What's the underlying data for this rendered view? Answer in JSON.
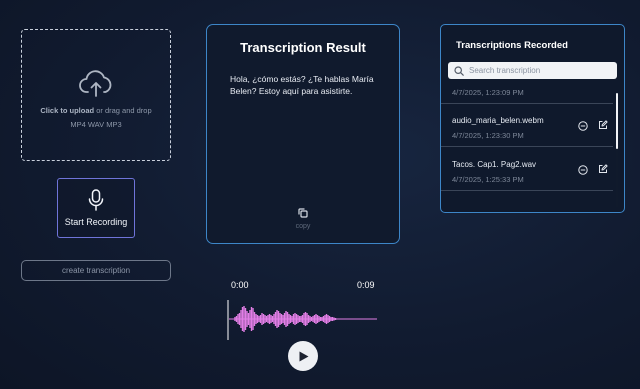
{
  "upload": {
    "icon": "cloud-upload-icon",
    "click_text": "Click to upload",
    "rest_text": " or drag and drop",
    "formats": "MP4 WAV MP3"
  },
  "record": {
    "icon": "microphone-icon",
    "label": "Start Recording"
  },
  "create": {
    "label": "create transcription"
  },
  "result": {
    "title": "Transcription Result",
    "text": "Hola, ¿cómo estás? ¿Te hablas María Belen? Estoy aquí para asistirte.",
    "copy_icon": "copy-icon",
    "copy_label": "copy"
  },
  "recorded": {
    "title": "Transcriptions Recorded",
    "search_placeholder": "Search transcription",
    "items": [
      {
        "name": "",
        "date": "4/7/2025, 1:23:09 PM"
      },
      {
        "name": "audio_maria_belen.webm",
        "date": "4/7/2025, 1:23:30 PM"
      },
      {
        "name": "Tacos. Cap1. Pag2.wav",
        "date": "4/7/2025, 1:25:33 PM"
      }
    ]
  },
  "player": {
    "current_time": "0:00",
    "duration": "0:09",
    "wave_color": "#e27ee6",
    "play_icon": "play-icon"
  },
  "colors": {
    "accent_border": "#3d86c8",
    "record_border": "#6f74d9"
  }
}
